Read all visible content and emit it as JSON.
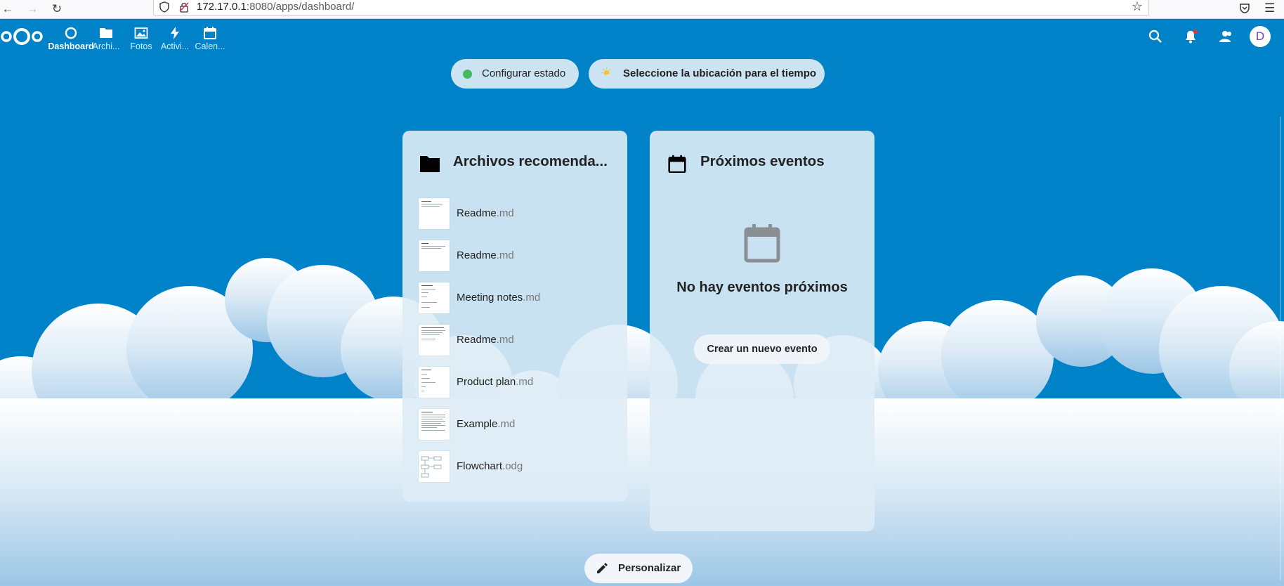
{
  "browser": {
    "url_host": "172.17.0.1",
    "url_path": ":8080/apps/dashboard/"
  },
  "header": {
    "apps": [
      {
        "label": "Dashboard",
        "icon": "dashboard-icon"
      },
      {
        "label": "Archi...",
        "icon": "folder-icon"
      },
      {
        "label": "Fotos",
        "icon": "image-icon"
      },
      {
        "label": "Activi...",
        "icon": "lightning-icon"
      },
      {
        "label": "Calen...",
        "icon": "calendar-icon"
      }
    ],
    "avatar_initial": "D"
  },
  "status": {
    "set_status_label": "Configurar estado",
    "weather_label": "Seleccione la ubicación para el tiempo"
  },
  "files_widget": {
    "title": "Archivos recomenda...",
    "items": [
      {
        "name": "Readme",
        "ext": ".md"
      },
      {
        "name": "Readme",
        "ext": ".md"
      },
      {
        "name": "Meeting notes",
        "ext": ".md"
      },
      {
        "name": "Readme",
        "ext": ".md"
      },
      {
        "name": "Product plan",
        "ext": ".md"
      },
      {
        "name": "Example",
        "ext": ".md"
      },
      {
        "name": "Flowchart",
        "ext": ".odg"
      }
    ]
  },
  "events_widget": {
    "title": "Próximos eventos",
    "empty_text": "No hay eventos próximos",
    "new_event_label": "Crear un nuevo evento"
  },
  "customize_label": "Personalizar",
  "colors": {
    "brand": "#0082c9",
    "status_online": "#46ba61"
  }
}
